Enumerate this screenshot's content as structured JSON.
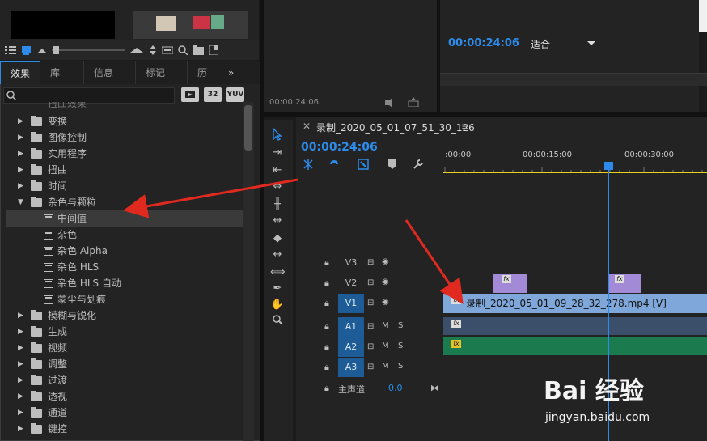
{
  "project": {
    "toolbar_icons": [
      "list-view-icon",
      "icon-view-icon",
      "zoom-slider-icon",
      "sort-icon",
      "search-icon",
      "new-bin-icon",
      "new-item-icon"
    ]
  },
  "effects_panel": {
    "tabs": [
      {
        "label": "效果",
        "active": true
      },
      {
        "label": "库",
        "active": false
      },
      {
        "label": "信息",
        "active": false
      },
      {
        "label": "标记",
        "active": false
      },
      {
        "label": "历",
        "active": false
      }
    ],
    "overflow_icon": "»",
    "filter_buttons": [
      "32",
      "YUV"
    ],
    "cut_item": "扭曲效果",
    "items": [
      {
        "label": "变换",
        "type": "folder",
        "expanded": false
      },
      {
        "label": "图像控制",
        "type": "folder",
        "expanded": false
      },
      {
        "label": "实用程序",
        "type": "folder",
        "expanded": false
      },
      {
        "label": "扭曲",
        "type": "folder",
        "expanded": false
      },
      {
        "label": "时间",
        "type": "folder",
        "expanded": false
      },
      {
        "label": "杂色与颗粒",
        "type": "folder",
        "expanded": true
      },
      {
        "label": "中间值",
        "type": "effect",
        "selected": true
      },
      {
        "label": "杂色",
        "type": "effect"
      },
      {
        "label": "杂色 Alpha",
        "type": "effect"
      },
      {
        "label": "杂色 HLS",
        "type": "effect"
      },
      {
        "label": "杂色 HLS 自动",
        "type": "effect"
      },
      {
        "label": "蒙尘与划痕",
        "type": "effect"
      },
      {
        "label": "模糊与锐化",
        "type": "folder",
        "expanded": false
      },
      {
        "label": "生成",
        "type": "folder",
        "expanded": false
      },
      {
        "label": "视频",
        "type": "folder",
        "expanded": false
      },
      {
        "label": "调整",
        "type": "folder",
        "expanded": false
      },
      {
        "label": "过渡",
        "type": "folder",
        "expanded": false
      },
      {
        "label": "透视",
        "type": "folder",
        "expanded": false
      },
      {
        "label": "通道",
        "type": "folder",
        "expanded": false
      },
      {
        "label": "键控",
        "type": "folder",
        "expanded": false
      }
    ]
  },
  "source_monitor": {
    "timecode": "00:00:24:06"
  },
  "program_monitor": {
    "timecode": "00:00:24:06",
    "fit_label": "适合"
  },
  "timeline": {
    "sequence_name": "录制_2020_05_01_07_51_30_126",
    "timecode": "00:00:24:06",
    "ruler_labels": [
      ":00:00",
      "00:00:15:00",
      "00:00:30:00"
    ],
    "tracks": [
      {
        "name": "V3",
        "kind": "video",
        "target": false
      },
      {
        "name": "V2",
        "kind": "video",
        "target": false
      },
      {
        "name": "V1",
        "kind": "video",
        "target": true
      },
      {
        "name": "A1",
        "kind": "audio",
        "target": true
      },
      {
        "name": "A2",
        "kind": "audio",
        "target": true
      },
      {
        "name": "A3",
        "kind": "audio",
        "target": true
      }
    ],
    "audio_toggle_m": "M",
    "audio_toggle_s": "S",
    "master_label": "主声道",
    "master_value": "0.0",
    "v1_clip_label": "录制_2020_05_01_09_28_32_278.mp4 [V]",
    "fx_badge": "fx"
  },
  "watermark": {
    "brand": "Bai 经验",
    "url": "jingyan.baidu.com"
  },
  "colors": {
    "accent": "#2d8ceb",
    "ruler_yellow": "#e8d21d",
    "v2_clip": "#a28ad6",
    "v1_clip": "#7fa7d9",
    "a1_clip": "#3b4e6a",
    "a2_clip": "#1c7a4f",
    "annotation": "#e02a1f"
  }
}
